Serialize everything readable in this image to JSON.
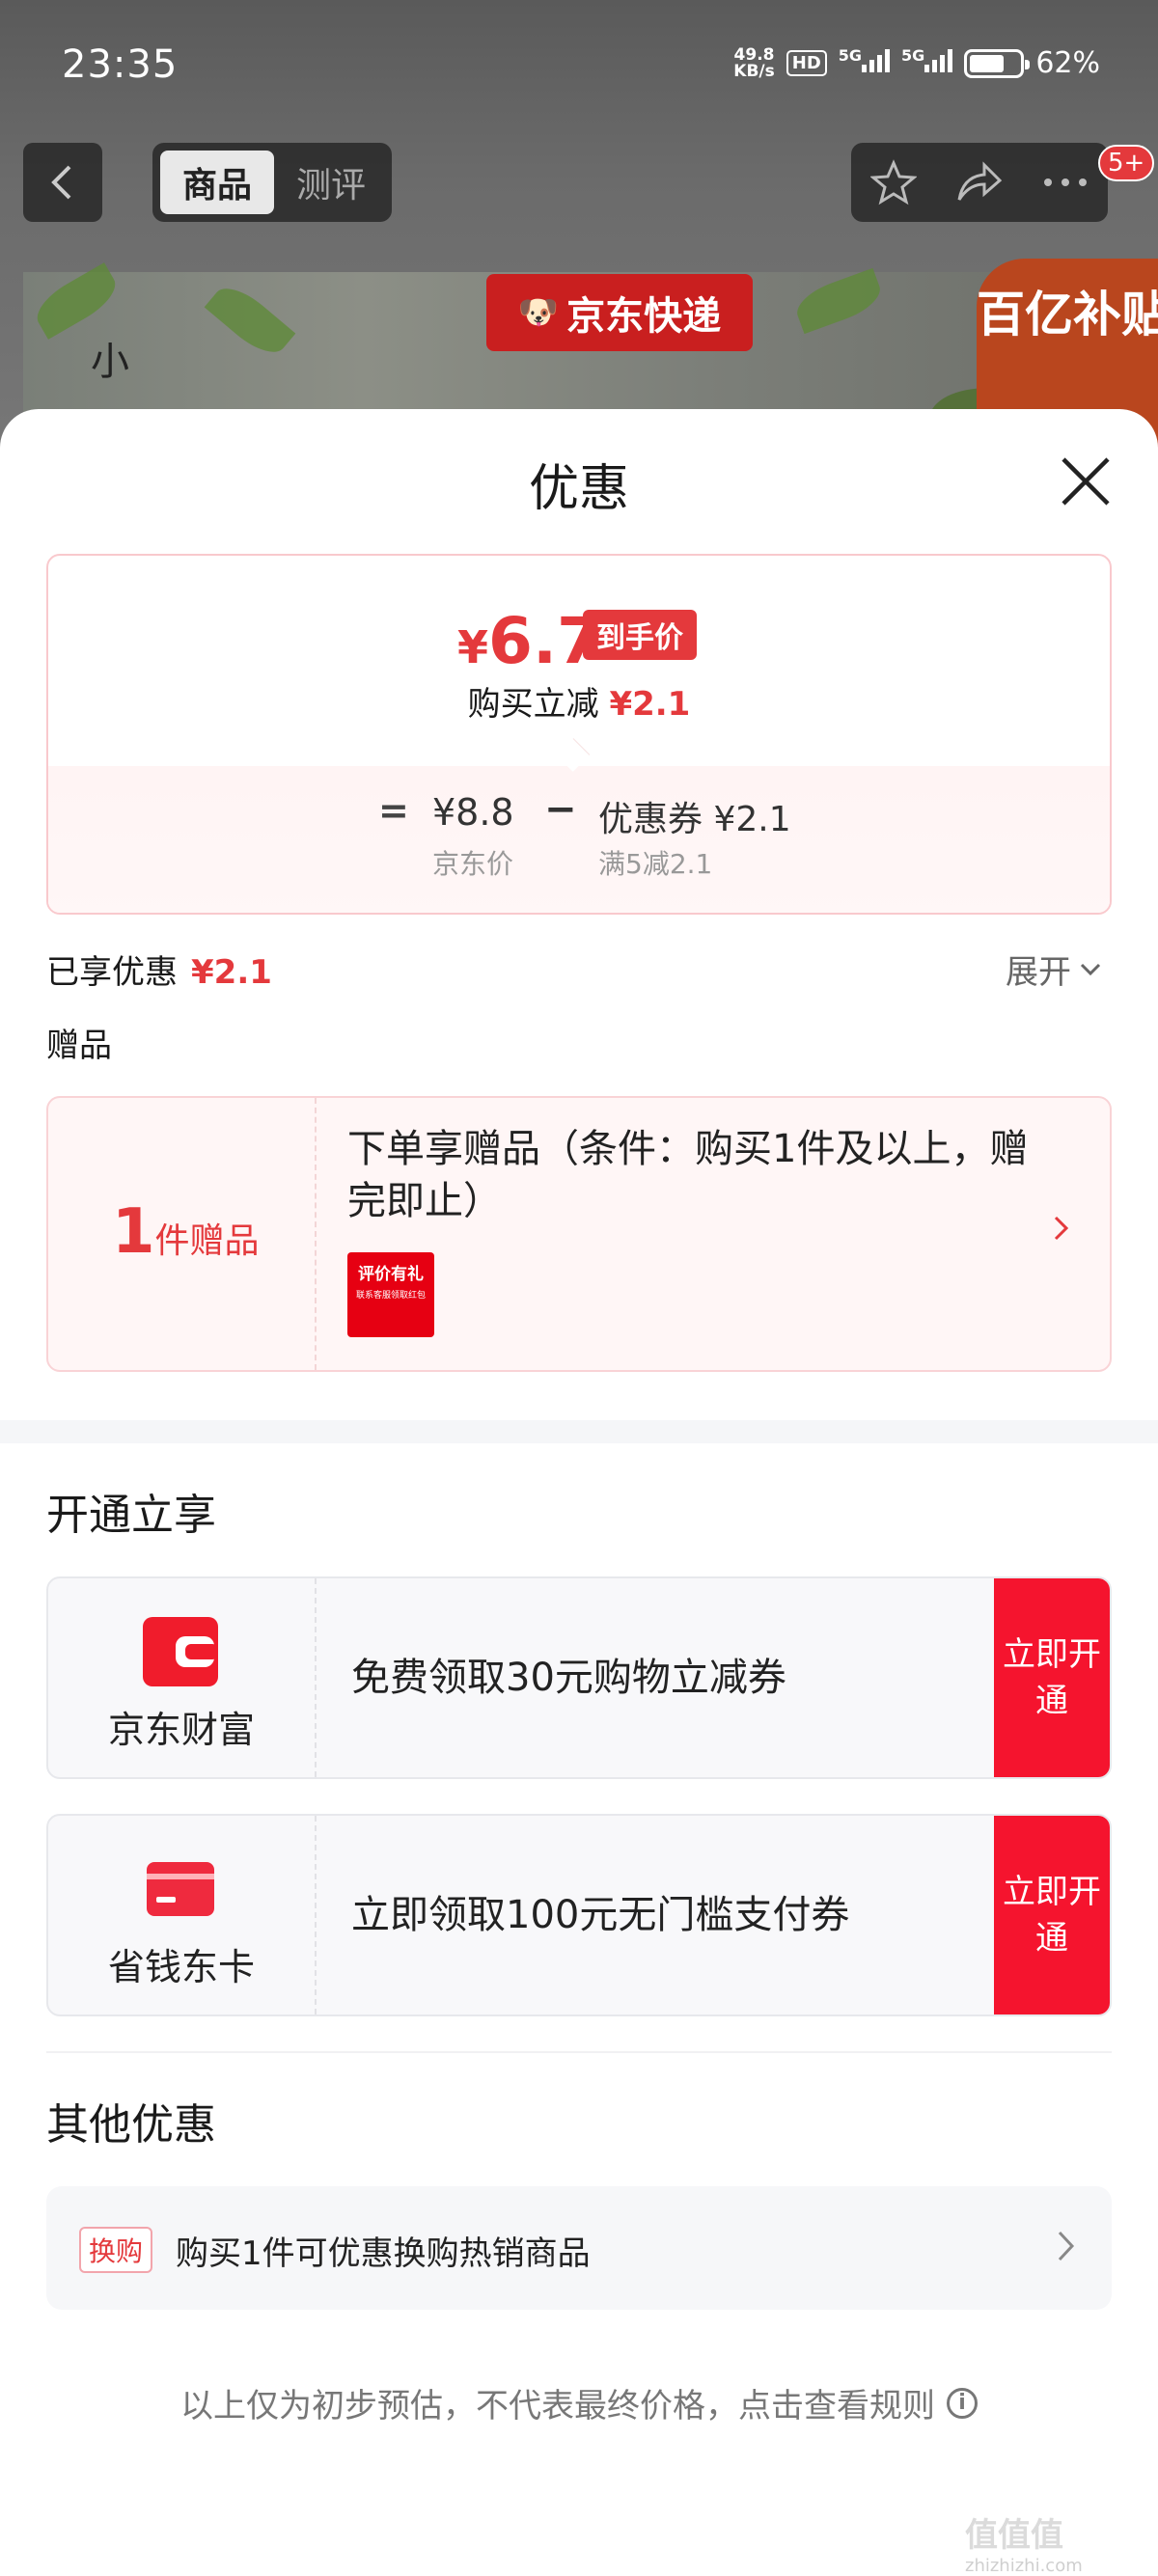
{
  "status_bar": {
    "time": "23:35",
    "net_speed_value": "49.8",
    "net_speed_unit": "KB/s",
    "hd": "HD",
    "signal1": "5G",
    "signal2": "5G",
    "battery": "62%"
  },
  "nav": {
    "tab_product": "商品",
    "tab_review": "测评",
    "badge": "5+"
  },
  "hero": {
    "express_label": "京东快递",
    "subsidy_label": "百亿补贴",
    "side_text": "小"
  },
  "sheet": {
    "title": "优惠"
  },
  "price": {
    "currency": "¥",
    "final_price": "6.7",
    "final_tag": "到手价",
    "reduce_label": "购买立减",
    "reduce_value": "¥2.1",
    "equals": "=",
    "jd_price": "¥8.8",
    "jd_price_label": "京东价",
    "minus": "−",
    "coupon": "优惠券 ¥2.1",
    "coupon_condition": "满5减2.1"
  },
  "enjoyed": {
    "label": "已享优惠",
    "value": "¥2.1",
    "expand": "展开"
  },
  "gift": {
    "section_title": "赠品",
    "count": "1",
    "count_unit": "件赠品",
    "description": "下单享赠品（条件：购买1件及以上，赠完即止）",
    "thumb_title": "评价有礼",
    "thumb_sub": "联系客服领取红包"
  },
  "open_section": {
    "title": "开通立享",
    "cards": [
      {
        "name": "京东财富",
        "desc": "免费领取30元购物立减券",
        "button": "立即开通"
      },
      {
        "name": "省钱东卡",
        "desc": "立即领取100元无门槛支付券",
        "button": "立即开通"
      }
    ]
  },
  "other_section": {
    "title": "其他优惠",
    "tag": "换购",
    "text": "购买1件可优惠换购热销商品"
  },
  "footer": {
    "note": "以上仅为初步预估，不代表最终价格，点击查看规则"
  },
  "watermark": {
    "text": "值值值",
    "url": "zhizhizhi.com"
  },
  "colors": {
    "accent": "#e4393c",
    "button_red": "#f5142e"
  }
}
